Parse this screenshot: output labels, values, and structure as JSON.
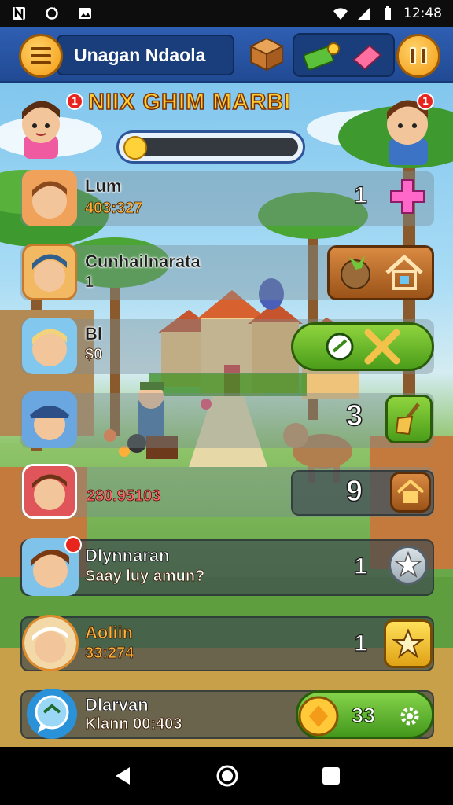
{
  "status_bar": {
    "time": "12:48"
  },
  "header": {
    "title": "Unagan Ndaola"
  },
  "banner": {
    "title": "NIIX GHIM MARBI",
    "progress_fraction": 0.06,
    "left_badge": "1",
    "right_badge": "1"
  },
  "rows": [
    {
      "name": "Lum",
      "value": "403:327",
      "count": "1",
      "action_icon": "plus-icon"
    },
    {
      "name": "Cunhailnarata",
      "value": "1",
      "count": "",
      "action_icon": "house-icon"
    },
    {
      "name": "Bl",
      "value": "$0",
      "count": "",
      "action_icon": "tools-icon"
    },
    {
      "name": "",
      "value": "",
      "count": "3",
      "action_icon": "broom-icon"
    },
    {
      "name": "",
      "value": "280.95103",
      "count": "9",
      "action_icon": "house-icon"
    },
    {
      "name": "Dlynnaran",
      "value": "Saay luy amun?",
      "count": "1",
      "action_icon": "star-icon"
    },
    {
      "name": "Aoliin",
      "value": "33:274",
      "count": "1",
      "action_icon": "star-icon"
    },
    {
      "name": "Dlarvan",
      "value": "Klann 00:403",
      "count": "",
      "action_icon": "coin-icon"
    }
  ],
  "coins": {
    "value": "33"
  }
}
